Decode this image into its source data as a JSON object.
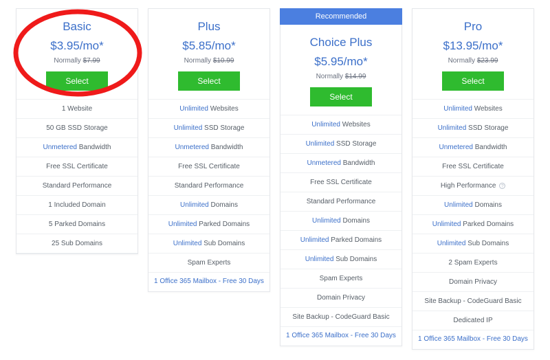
{
  "recommended_label": "Recommended",
  "select_label": "Select",
  "normally_prefix": "Normally ",
  "plans": [
    {
      "name": "Basic",
      "price": "$3.95/mo*",
      "normally": "$7.99",
      "recommended": false,
      "features": [
        {
          "kw": "",
          "rest": "1 Website"
        },
        {
          "kw": "",
          "rest": "50 GB SSD Storage"
        },
        {
          "kw": "Unmetered",
          "rest": " Bandwidth"
        },
        {
          "kw": "",
          "rest": "Free SSL Certificate"
        },
        {
          "kw": "",
          "rest": "Standard Performance"
        },
        {
          "kw": "",
          "rest": "1 Included Domain"
        },
        {
          "kw": "",
          "rest": "5 Parked Domains"
        },
        {
          "kw": "",
          "rest": "25 Sub Domains"
        }
      ],
      "office": ""
    },
    {
      "name": "Plus",
      "price": "$5.85/mo*",
      "normally": "$10.99",
      "recommended": false,
      "features": [
        {
          "kw": "Unlimited",
          "rest": " Websites"
        },
        {
          "kw": "Unlimited",
          "rest": " SSD Storage"
        },
        {
          "kw": "Unmetered",
          "rest": " Bandwidth"
        },
        {
          "kw": "",
          "rest": "Free SSL Certificate"
        },
        {
          "kw": "",
          "rest": "Standard Performance"
        },
        {
          "kw": "Unlimited",
          "rest": " Domains"
        },
        {
          "kw": "Unlimited",
          "rest": " Parked Domains"
        },
        {
          "kw": "Unlimited",
          "rest": " Sub Domains"
        },
        {
          "kw": "",
          "rest": "Spam Experts"
        }
      ],
      "office": "1 Office 365 Mailbox - Free 30 Days"
    },
    {
      "name": "Choice Plus",
      "price": "$5.95/mo*",
      "normally": "$14.99",
      "recommended": true,
      "features": [
        {
          "kw": "Unlimited",
          "rest": " Websites"
        },
        {
          "kw": "Unlimited",
          "rest": " SSD Storage"
        },
        {
          "kw": "Unmetered",
          "rest": " Bandwidth"
        },
        {
          "kw": "",
          "rest": "Free SSL Certificate"
        },
        {
          "kw": "",
          "rest": "Standard Performance"
        },
        {
          "kw": "Unlimited",
          "rest": " Domains"
        },
        {
          "kw": "Unlimited",
          "rest": " Parked Domains"
        },
        {
          "kw": "Unlimited",
          "rest": " Sub Domains"
        },
        {
          "kw": "",
          "rest": "Spam Experts"
        },
        {
          "kw": "",
          "rest": "Domain Privacy"
        },
        {
          "kw": "",
          "rest": "Site Backup - CodeGuard Basic"
        }
      ],
      "office": "1 Office 365 Mailbox - Free 30 Days"
    },
    {
      "name": "Pro",
      "price": "$13.95/mo*",
      "normally": "$23.99",
      "recommended": false,
      "features": [
        {
          "kw": "Unlimited",
          "rest": " Websites"
        },
        {
          "kw": "Unlimited",
          "rest": " SSD Storage"
        },
        {
          "kw": "Unmetered",
          "rest": " Bandwidth"
        },
        {
          "kw": "",
          "rest": "Free SSL Certificate"
        },
        {
          "kw": "",
          "rest": "High Performance",
          "info": true
        },
        {
          "kw": "Unlimited",
          "rest": " Domains"
        },
        {
          "kw": "Unlimited",
          "rest": " Parked Domains"
        },
        {
          "kw": "Unlimited",
          "rest": " Sub Domains"
        },
        {
          "kw": "",
          "rest": "2 Spam Experts"
        },
        {
          "kw": "",
          "rest": "Domain Privacy"
        },
        {
          "kw": "",
          "rest": "Site Backup - CodeGuard Basic"
        },
        {
          "kw": "",
          "rest": "Dedicated IP"
        }
      ],
      "office": "1 Office 365 Mailbox - Free 30 Days"
    }
  ]
}
